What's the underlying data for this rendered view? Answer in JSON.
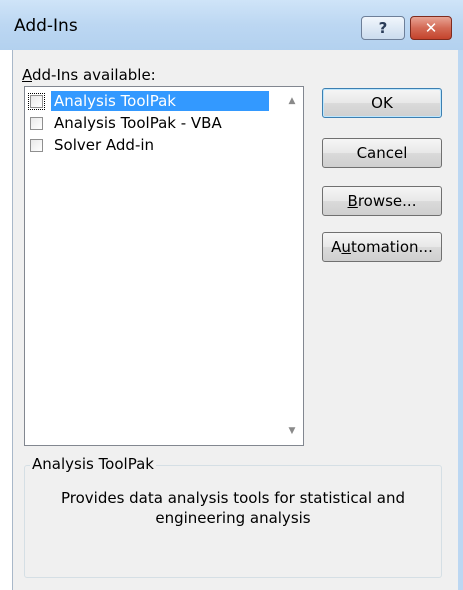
{
  "window": {
    "title": "Add-Ins",
    "help_glyph": "?",
    "close_glyph": "✕"
  },
  "addins_list": {
    "label_accesskey": "A",
    "label_rest": "dd-Ins available:",
    "items": [
      {
        "label": "Analysis ToolPak",
        "checked": false,
        "selected": true
      },
      {
        "label": "Analysis ToolPak - VBA",
        "checked": false,
        "selected": false
      },
      {
        "label": "Solver Add-in",
        "checked": false,
        "selected": false
      }
    ]
  },
  "buttons": {
    "ok": "OK",
    "cancel": "Cancel",
    "browse_accesskey": "B",
    "browse_rest": "rowse...",
    "automation_pre": "A",
    "automation_accesskey": "u",
    "automation_rest": "tomation..."
  },
  "description": {
    "title": "Analysis ToolPak",
    "text": "Provides data analysis tools for statistical and engineering analysis"
  },
  "colors": {
    "selection": "#3399ff",
    "titlebar": "#bcd7f2",
    "close_button": "#c4432c"
  }
}
